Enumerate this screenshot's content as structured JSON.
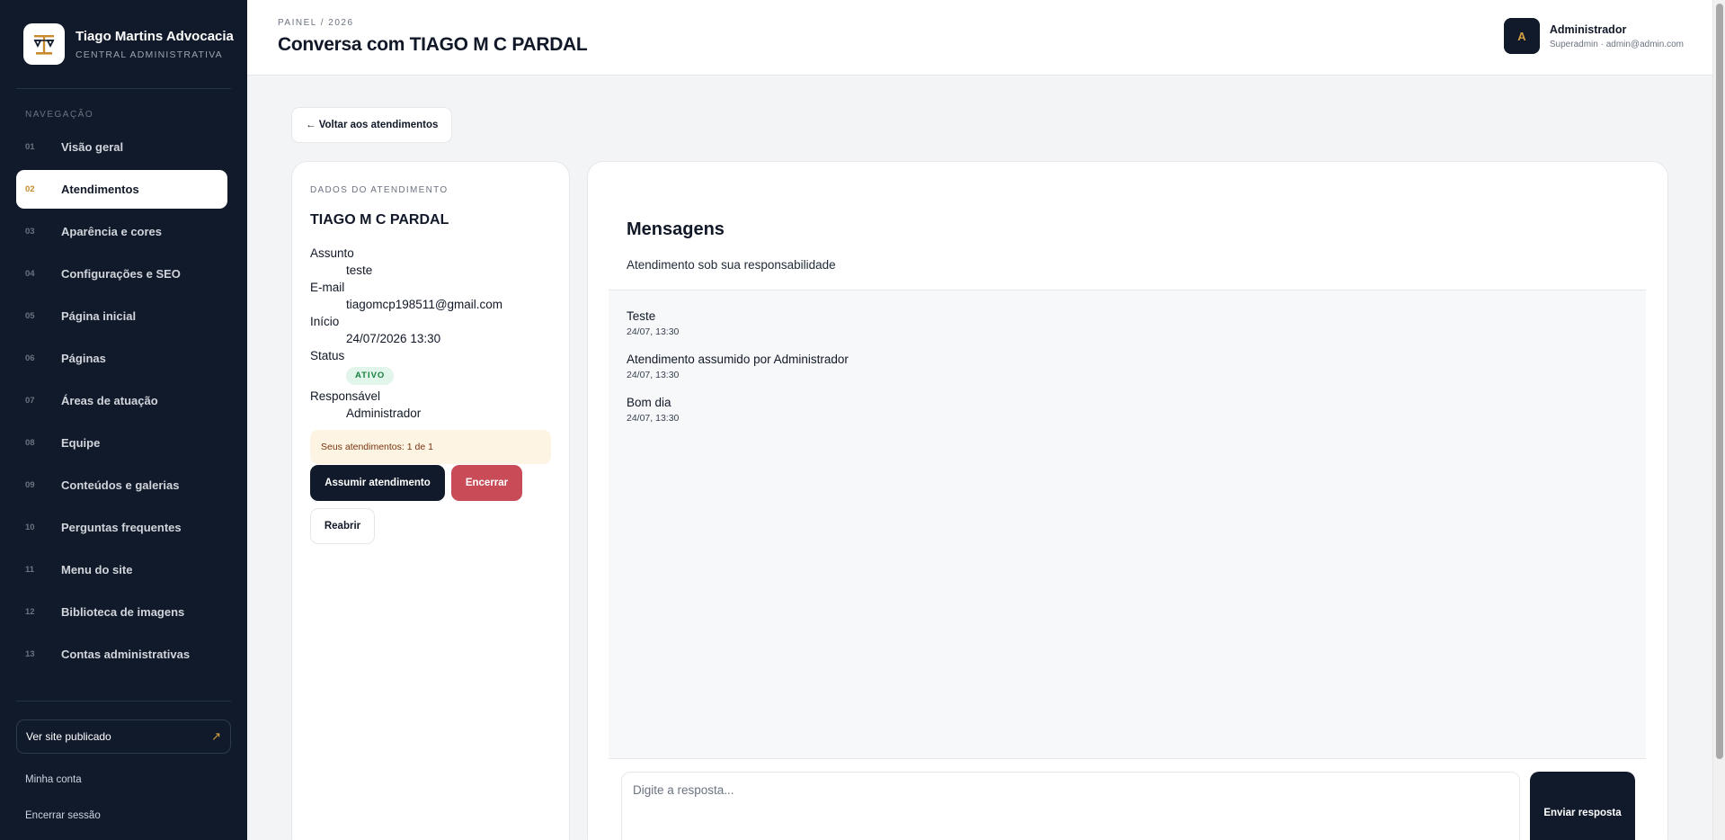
{
  "brand": {
    "name": "Tiago Martins Advocacia",
    "subtitle": "CENTRAL ADMINISTRATIVA",
    "logo_icon": "scales-of-justice-icon"
  },
  "sidebar": {
    "nav_title": "NAVEGAÇÃO",
    "items": [
      {
        "num": "01",
        "label": "Visão geral"
      },
      {
        "num": "02",
        "label": "Atendimentos",
        "active": true
      },
      {
        "num": "03",
        "label": "Aparência e cores"
      },
      {
        "num": "04",
        "label": "Configurações e SEO"
      },
      {
        "num": "05",
        "label": "Página inicial"
      },
      {
        "num": "06",
        "label": "Páginas"
      },
      {
        "num": "07",
        "label": "Áreas de atuação"
      },
      {
        "num": "08",
        "label": "Equipe"
      },
      {
        "num": "09",
        "label": "Conteúdos e galerias"
      },
      {
        "num": "10",
        "label": "Perguntas frequentes"
      },
      {
        "num": "11",
        "label": "Menu do site"
      },
      {
        "num": "12",
        "label": "Biblioteca de imagens"
      },
      {
        "num": "13",
        "label": "Contas administrativas"
      }
    ],
    "site_link": {
      "label": "Ver site publicado",
      "icon": "↗"
    },
    "account_link": "Minha conta",
    "logout_link": "Encerrar sessão"
  },
  "header": {
    "breadcrumb": "PAINEL / 2026",
    "title": "Conversa com TIAGO M C PARDAL",
    "user": {
      "initial": "A",
      "name": "Administrador",
      "role": "Superadmin · admin@admin.com"
    }
  },
  "back_button": "← Voltar aos atendimentos",
  "details": {
    "eyebrow": "DADOS DO ATENDIMENTO",
    "client": "TIAGO M C PARDAL",
    "fields": {
      "subject_label": "Assunto",
      "subject": "teste",
      "email_label": "E-mail",
      "email": "tiagomcp198511@gmail.com",
      "start_label": "Início",
      "start": "24/07/2026 13:30",
      "status_label": "Status",
      "status": "ATIVO",
      "owner_label": "Responsável",
      "owner": "Administrador"
    },
    "notice": "Seus atendimentos: 1 de 1",
    "buttons": {
      "assume": "Assumir atendimento",
      "close": "Encerrar",
      "reopen": "Reabrir"
    }
  },
  "messages": {
    "title": "Mensagens",
    "subtitle": "Atendimento sob sua responsabilidade",
    "items": [
      {
        "text": "Teste",
        "time": "24/07, 13:30"
      },
      {
        "text": "Atendimento assumido por Administrador",
        "time": "24/07, 13:30"
      },
      {
        "text": "Bom dia",
        "time": "24/07, 13:30"
      }
    ],
    "input_placeholder": "Digite a resposta...",
    "send_label": "Enviar resposta"
  },
  "colors": {
    "sidebar_bg": "#111a2a",
    "accent": "#d4a041",
    "danger": "#c84b57",
    "status_bg": "#e2f5ea",
    "status_text": "#15803d",
    "notice_bg": "#fdf4e3"
  }
}
